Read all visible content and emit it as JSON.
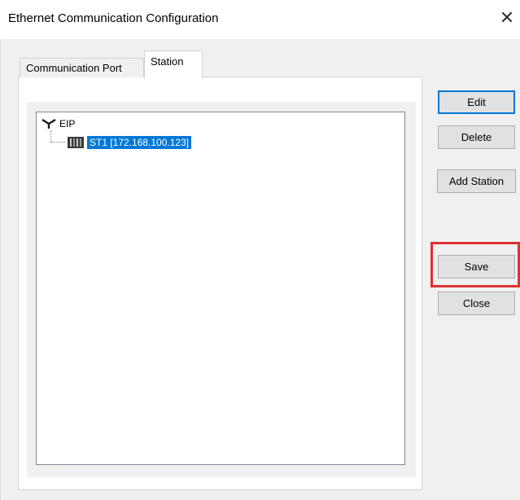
{
  "window": {
    "title": "Ethernet Communication Configuration",
    "close_glyph": "✕"
  },
  "tabs": [
    {
      "label": "Communication Port",
      "active": false
    },
    {
      "label": "Station",
      "active": true
    }
  ],
  "tree": {
    "root": {
      "label": "EIP",
      "icon": "antenna-icon"
    },
    "children": [
      {
        "label": "ST1 [172.168.100.123]",
        "icon": "station-icon",
        "selected": true
      }
    ]
  },
  "buttons": {
    "edit": "Edit",
    "delete": "Delete",
    "add_station": "Add Station",
    "save": "Save",
    "close": "Close"
  },
  "colors": {
    "selection": "#0078d7",
    "highlight_box": "#e03030"
  }
}
